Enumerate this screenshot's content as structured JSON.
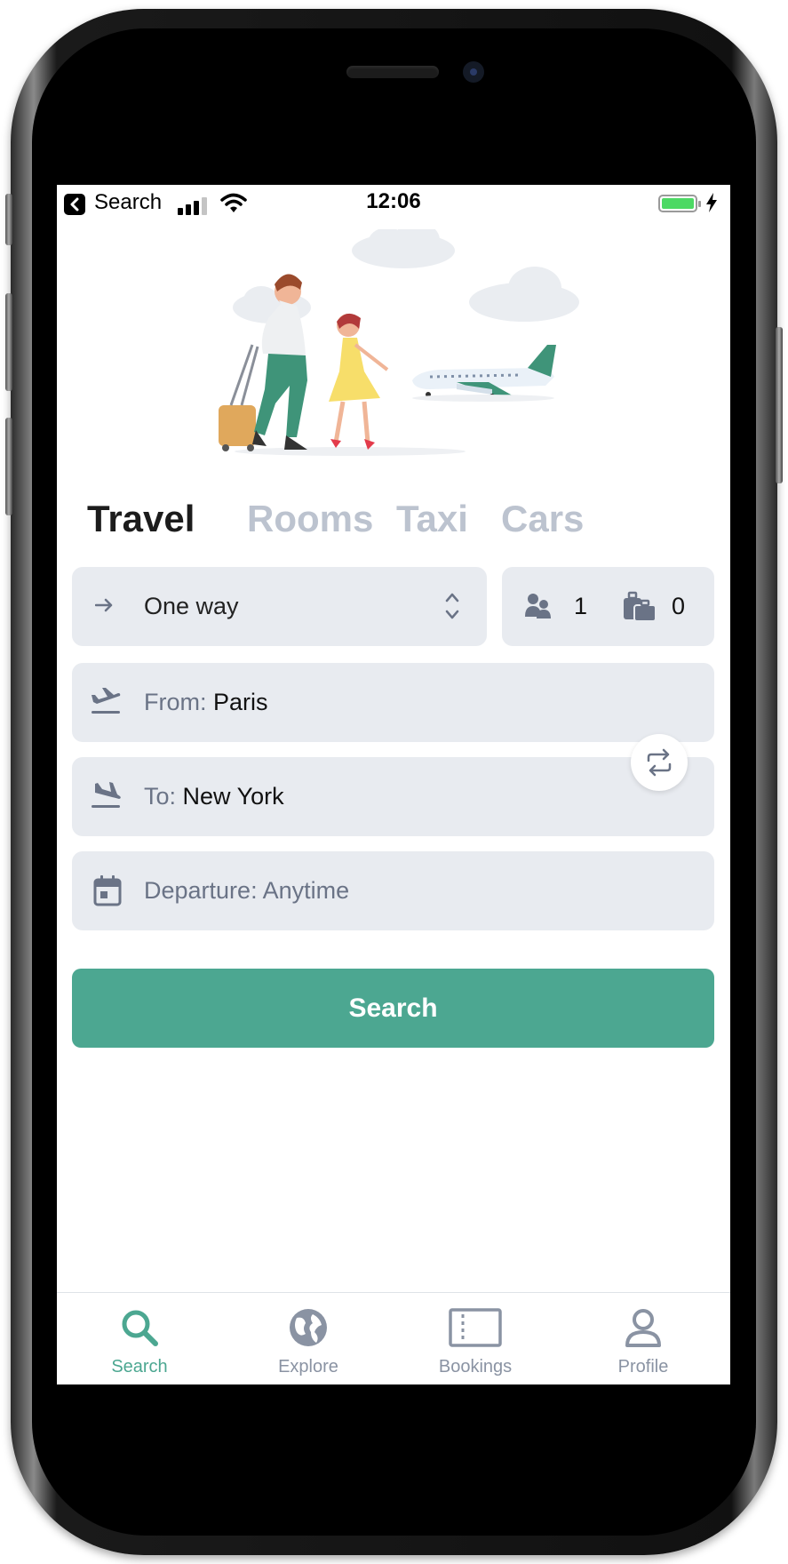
{
  "status_bar": {
    "back_label": "Search",
    "time": "12:06"
  },
  "tabs": [
    {
      "label": "Travel",
      "active": true
    },
    {
      "label": "Rooms",
      "active": false
    },
    {
      "label": "Taxi",
      "active": false
    },
    {
      "label": "Cars",
      "active": false
    }
  ],
  "trip": {
    "type": "One way",
    "passengers": "1",
    "bags": "0"
  },
  "from": {
    "label": "From:",
    "value": "Paris"
  },
  "to": {
    "label": "To:",
    "value": "New York"
  },
  "departure": {
    "label": "Departure: Anytime"
  },
  "search_button": "Search",
  "bottom_nav": [
    {
      "label": "Search",
      "icon": "search-icon",
      "active": true
    },
    {
      "label": "Explore",
      "icon": "globe-icon",
      "active": false
    },
    {
      "label": "Bookings",
      "icon": "ticket-icon",
      "active": false
    },
    {
      "label": "Profile",
      "icon": "person-icon",
      "active": false
    }
  ],
  "colors": {
    "accent": "#4ca791",
    "field_bg": "#e8ebf0",
    "muted_text": "#6a7386",
    "inactive_tab": "#bcc3cf"
  }
}
